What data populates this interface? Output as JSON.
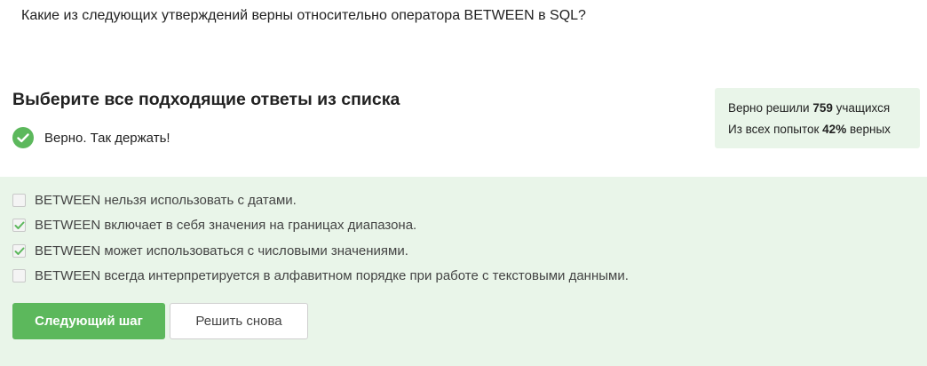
{
  "question": "Какие из следующих утверждений верны относительно оператора BETWEEN в SQL?",
  "choose_title": "Выберите все подходящие ответы из списка",
  "verdict": {
    "icon": "check-circle-icon",
    "text": "Верно. Так держать!",
    "color": "#5cb85c"
  },
  "stats": {
    "line1_prefix": "Верно решили",
    "solved_count": "759",
    "line1_suffix": "учащихся",
    "line2_prefix": "Из всех попыток",
    "percent": "42%",
    "line2_suffix": "верных"
  },
  "options": [
    {
      "text": "BETWEEN нельзя использовать с датами.",
      "checked": false
    },
    {
      "text": "BETWEEN включает в себя значения на границах диапазона.",
      "checked": true
    },
    {
      "text": "BETWEEN может использоваться с числовыми значениями.",
      "checked": true
    },
    {
      "text": "BETWEEN всегда интерпретируется в алфавитном порядке при работе с текстовыми данными.",
      "checked": false
    }
  ],
  "buttons": {
    "next_label": "Следующий шаг",
    "retry_label": "Решить снова"
  },
  "colors": {
    "accent": "#5cb85c",
    "panel_bg": "#e9f5e9"
  }
}
